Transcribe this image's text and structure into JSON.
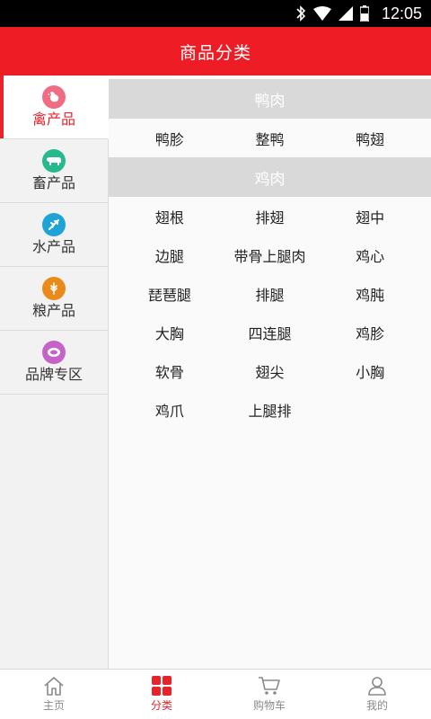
{
  "status_bar": {
    "time": "12:05"
  },
  "header": {
    "title": "商品分类"
  },
  "colors": {
    "brand": "#ee1c25",
    "active": "#e8232c"
  },
  "sidebar": {
    "items": [
      {
        "label": "禽产品",
        "icon": "rooster-icon",
        "color": "#f06c82",
        "active": true
      },
      {
        "label": "畜产品",
        "icon": "cow-icon",
        "color": "#27b88e",
        "active": false
      },
      {
        "label": "水产品",
        "icon": "fish-icon",
        "color": "#1ea3d8",
        "active": false
      },
      {
        "label": "粮产品",
        "icon": "grain-icon",
        "color": "#ea8a1a",
        "active": false
      },
      {
        "label": "品牌专区",
        "icon": "brand-icon",
        "color": "#c563c9",
        "active": false
      }
    ]
  },
  "sections": [
    {
      "title": "鸭肉",
      "items": [
        "鸭胗",
        "整鸭",
        "鸭翅"
      ]
    },
    {
      "title": "鸡肉",
      "items": [
        "翅根",
        "排翅",
        "翅中",
        "边腿",
        "带骨上腿肉",
        "鸡心",
        "琵琶腿",
        "排腿",
        "鸡肫",
        "大胸",
        "四连腿",
        "鸡胗",
        "软骨",
        "翅尖",
        "小胸",
        "鸡爪",
        "上腿排"
      ]
    }
  ],
  "bottom_nav": {
    "items": [
      {
        "label": "主页",
        "icon": "home-icon",
        "active": false
      },
      {
        "label": "分类",
        "icon": "category-icon",
        "active": true
      },
      {
        "label": "购物车",
        "icon": "cart-icon",
        "active": false
      },
      {
        "label": "我的",
        "icon": "profile-icon",
        "active": false
      }
    ]
  }
}
